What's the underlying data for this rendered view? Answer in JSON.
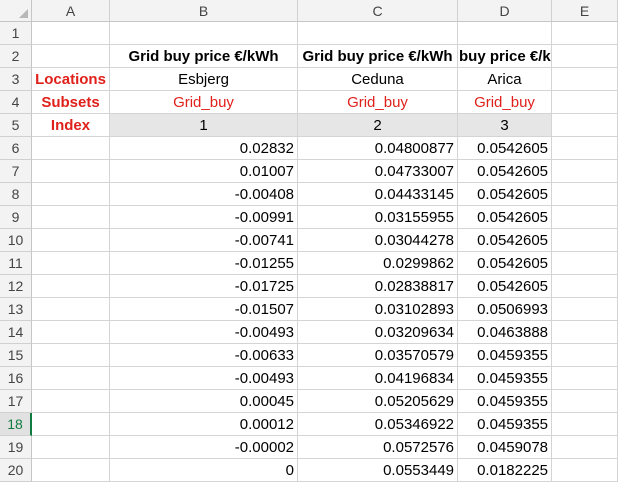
{
  "columns": [
    "A",
    "B",
    "C",
    "D",
    "E"
  ],
  "row_numbers": [
    "1",
    "2",
    "3",
    "4",
    "5",
    "6",
    "7",
    "8",
    "9",
    "10",
    "11",
    "12",
    "13",
    "14",
    "15",
    "16",
    "17",
    "18",
    "19",
    "20"
  ],
  "selected_row": "18",
  "labels": {
    "locations": "Locations",
    "subsets": "Subsets",
    "index": "Index"
  },
  "headers": {
    "b": "Grid buy price €/kWh",
    "c": "Grid buy price €/kWh",
    "d": "buy price €/kWh"
  },
  "locations": {
    "b": "Esbjerg",
    "c": "Ceduna",
    "d": "Arica"
  },
  "subsets": {
    "b": "Grid_buy",
    "c": "Grid_buy",
    "d": "Grid_buy"
  },
  "index": {
    "b": "1",
    "c": "2",
    "d": "3"
  },
  "data": {
    "b": [
      "0.02832",
      "0.01007",
      "-0.00408",
      "-0.00991",
      "-0.00741",
      "-0.01255",
      "-0.01725",
      "-0.01507",
      "-0.00493",
      "-0.00633",
      "-0.00493",
      "0.00045",
      "0.00012",
      "-0.00002",
      "0"
    ],
    "c": [
      "0.04800877",
      "0.04733007",
      "0.04433145",
      "0.03155955",
      "0.03044278",
      "0.0299862",
      "0.02838817",
      "0.03102893",
      "0.03209634",
      "0.03570579",
      "0.04196834",
      "0.05205629",
      "0.05346922",
      "0.0572576",
      "0.0553449"
    ],
    "d": [
      "0.0542605",
      "0.0542605",
      "0.0542605",
      "0.0542605",
      "0.0542605",
      "0.0542605",
      "0.0542605",
      "0.0506993",
      "0.0463888",
      "0.0459355",
      "0.0459355",
      "0.0459355",
      "0.0459355",
      "0.0459078",
      "0.0182225"
    ]
  },
  "colors": {
    "red_text": "#e0201a",
    "header_bg": "#f3f3f3",
    "selected_row": "#107c41",
    "index_fill": "#e6e6e6"
  }
}
